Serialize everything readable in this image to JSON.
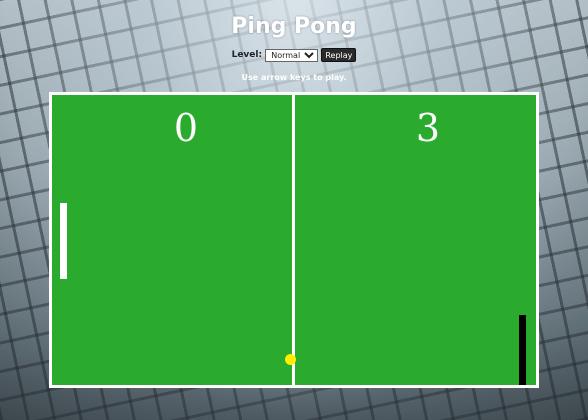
{
  "title": "Ping Pong",
  "controls": {
    "level_label": "Level:",
    "level_selected": "Normal",
    "replay_label": "Replay"
  },
  "hint": "Use arrow keys to play.",
  "scores": {
    "left": "0",
    "right": "3"
  },
  "colors": {
    "court": "#2aab2e",
    "lines": "#ffffff",
    "left_paddle": "#ffffff",
    "right_paddle": "#000000",
    "ball": "#ffee00"
  }
}
